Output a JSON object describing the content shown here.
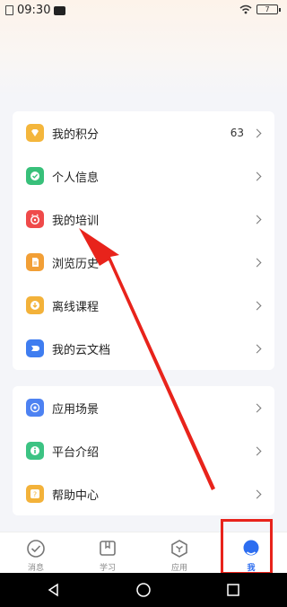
{
  "status_bar": {
    "time": "09:30",
    "battery": "7"
  },
  "menu_group1": [
    {
      "name": "points",
      "label": "我的积分",
      "value": "63",
      "icon": "diamond-icon",
      "color": "#f4b63c"
    },
    {
      "name": "personal-info",
      "label": "个人信息",
      "icon": "shield-check-icon",
      "color": "#38c07a"
    },
    {
      "name": "my-training",
      "label": "我的培训",
      "icon": "alarm-clock-icon",
      "color": "#ef4a4a"
    },
    {
      "name": "browse-history",
      "label": "浏览历史",
      "icon": "document-icon",
      "color": "#f29f36"
    },
    {
      "name": "offline-courses",
      "label": "离线课程",
      "icon": "download-icon",
      "color": "#f3b23a"
    },
    {
      "name": "cloud-docs",
      "label": "我的云文档",
      "icon": "cloud-doc-icon",
      "color": "#3f7df0"
    }
  ],
  "menu_group2": [
    {
      "name": "app-scenarios",
      "label": "应用场景",
      "icon": "orbit-icon",
      "color": "#4d82f2"
    },
    {
      "name": "platform-intro",
      "label": "平台介绍",
      "icon": "info-icon",
      "color": "#3cc383"
    },
    {
      "name": "help-center",
      "label": "帮助中心",
      "icon": "question-icon",
      "color": "#f3b23a"
    }
  ],
  "tabbar": [
    {
      "name": "messages",
      "label": "消息",
      "icon": "check-circle-icon"
    },
    {
      "name": "study",
      "label": "学习",
      "icon": "book-icon"
    },
    {
      "name": "apps",
      "label": "应用",
      "icon": "hexagon-icon"
    },
    {
      "name": "me",
      "label": "我",
      "icon": "person-icon",
      "active": true
    }
  ],
  "colors": {
    "accent": "#2c6df0",
    "annotation": "#e8231b"
  }
}
